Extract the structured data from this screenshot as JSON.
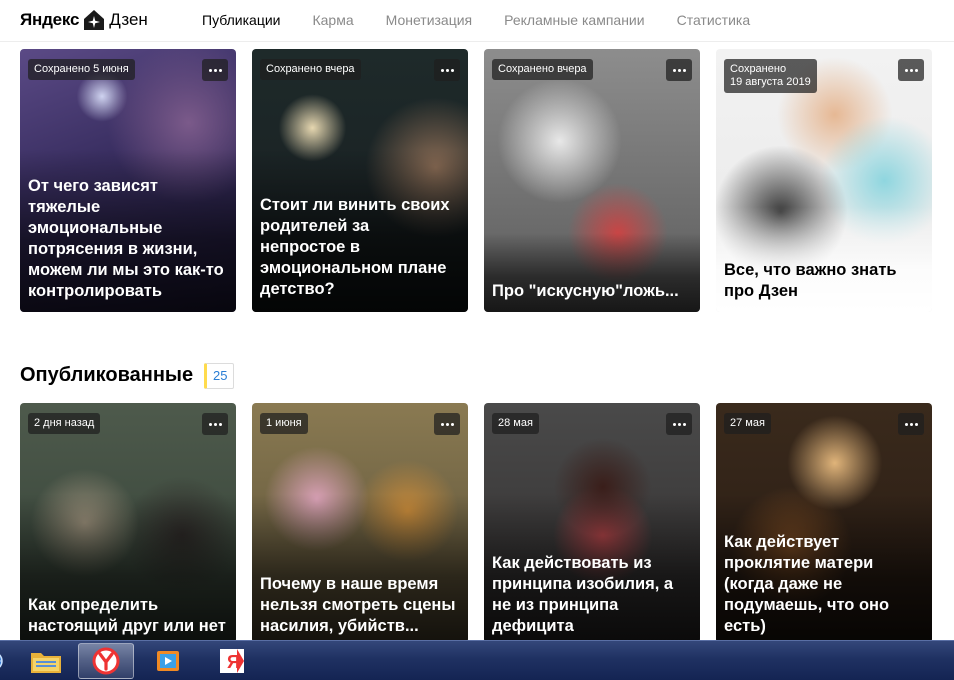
{
  "header": {
    "logo_text": "Яндекс",
    "logo_text2": "Дзен",
    "nav": [
      {
        "label": "Публикации",
        "active": true
      },
      {
        "label": "Карма",
        "active": false
      },
      {
        "label": "Монетизация",
        "active": false
      },
      {
        "label": "Рекламные кампании",
        "active": false
      },
      {
        "label": "Статистика",
        "active": false
      }
    ]
  },
  "drafts": [
    {
      "date": "Сохранено 5 июня",
      "title": "От чего зависят тяжелые эмоциональные потрясения в жизни, можем ли мы это как-то контролировать"
    },
    {
      "date": "Сохранено вчера",
      "title": "Стоит ли винить своих родителей за непростое в эмоциональном плане детство?"
    },
    {
      "date": "Сохранено вчера",
      "title": "Про \"искусную\"ложь..."
    },
    {
      "date_line1": "Сохранено",
      "date_line2": "19 августа 2019",
      "title": "Все, что важно знать про Дзен"
    }
  ],
  "published_section": {
    "title": "Опубликованные",
    "count": "25"
  },
  "published": [
    {
      "date": "2 дня назад",
      "title": "Как определить настоящий друг или нет"
    },
    {
      "date": "1 июня",
      "title": "Почему в наше время нельзя смотреть сцены насилия, убийств..."
    },
    {
      "date": "28 мая",
      "title": "Как действовать из принципа изобилия, а не из принципа дефицита"
    },
    {
      "date": "27 мая",
      "title": "Как действует проклятие матери (когда даже не подумаешь, что оно есть)"
    }
  ],
  "taskbar": {
    "items": [
      "globe-icon",
      "folder-icon",
      "yandex-browser-icon",
      "media-player-icon",
      "yandex-app-icon"
    ]
  },
  "colors": {
    "accent": "#ffdb4d",
    "link": "#2a7ed4",
    "taskbar": "#1f3162"
  }
}
